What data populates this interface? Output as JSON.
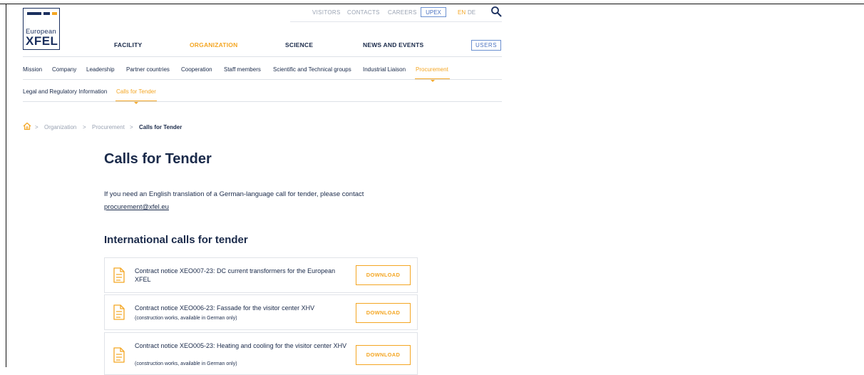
{
  "logo": {
    "line1": "European",
    "line2": "XFEL"
  },
  "utility_nav": {
    "items": [
      "VISITORS",
      "CONTACTS",
      "CAREERS"
    ],
    "upex": "UPEX",
    "lang_en": "EN",
    "lang_de": "DE"
  },
  "main_nav": {
    "items": [
      "FACILITY",
      "ORGANIZATION",
      "SCIENCE",
      "NEWS AND EVENTS"
    ],
    "active": "ORGANIZATION",
    "users_button": "USERS"
  },
  "sub_nav": {
    "items": [
      "Mission",
      "Company",
      "Leadership",
      "Partner countries",
      "Cooperation",
      "Staff members",
      "Scientific and Technical groups",
      "Industrial Liaison",
      "Procurement"
    ],
    "active": "Procurement"
  },
  "sub_sub_nav": {
    "items": [
      "Legal and Regulatory Information",
      "Calls for Tender"
    ],
    "active": "Calls for Tender"
  },
  "breadcrumb": {
    "items": [
      "Organization",
      "Procurement",
      "Calls for Tender"
    ],
    "separator": ">"
  },
  "main": {
    "title": "Calls for Tender",
    "intro": "If you need an English translation of a German-language call for tender, please contact",
    "email": "procurement@xfel.eu",
    "section_title": "International calls for tender",
    "tenders": [
      {
        "title": "Contract notice XEO007-23: DC current transformers for the European XFEL",
        "note": "",
        "button": "DOWNLOAD"
      },
      {
        "title": "Contract notice XEO006-23: Fassade for the visitor center XHV",
        "note": "(construction works, available in German only)",
        "button": "DOWNLOAD"
      },
      {
        "title": "Contract notice XEO005-23: Heating and cooling for the visitor center XHV",
        "note": "(construction works, available in German only)",
        "button": "DOWNLOAD"
      }
    ]
  },
  "colors": {
    "accent": "#f4a623",
    "navy": "#1a2f5e",
    "link_blue": "#4b72c0"
  }
}
